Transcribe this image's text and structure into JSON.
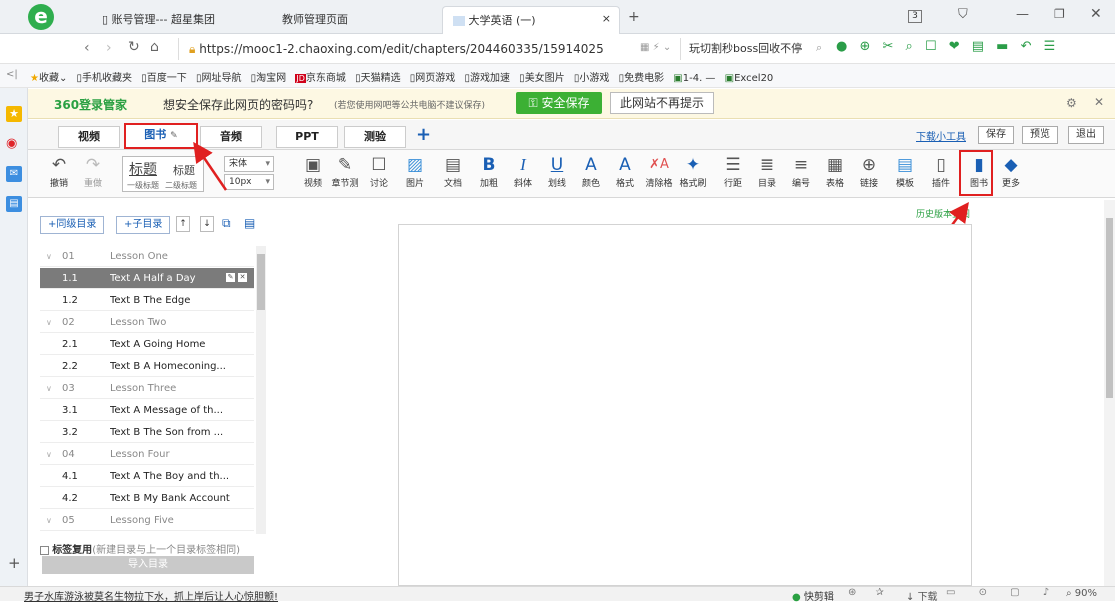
{
  "browser": {
    "tabs": [
      {
        "label": "账号管理--- 超星集团"
      },
      {
        "label": "教师管理页面"
      },
      {
        "label": "大学英语 (一)"
      }
    ],
    "tab_count": "3",
    "url": "https://mooc1-2.chaoxing.com/edit/chapters/204460335/15914025",
    "search_text": "玩切割秒boss回收不停",
    "bookmarks": [
      "收藏",
      "手机收藏夹",
      "百度一下",
      "网址导航",
      "淘宝网",
      "京东商城",
      "天猫精选",
      "网页游戏",
      "游戏加速",
      "美女图片",
      "小游戏",
      "免费电影",
      "1-4. —",
      "Excel20"
    ]
  },
  "password_bar": {
    "brand": "360登录管家",
    "question": "想安全保存此网页的密码吗?",
    "note": "(若您使用网吧等公共电脑不建议保存)",
    "save_button": "安全保存",
    "no_remind_button": "此网站不再提示"
  },
  "editor": {
    "tabs": [
      "视频",
      "图书",
      "音频",
      "PPT",
      "测验"
    ],
    "add_tab": "+",
    "top_links": {
      "download": "下载小工具",
      "save": "保存",
      "preview": "预览",
      "exit": "退出"
    },
    "history_link": "历史版本查阅",
    "toolbar": {
      "undo": "撤销",
      "redo": "重做",
      "heading_main": "标题",
      "heading_alt": "标题",
      "heading_level1": "一级标题",
      "heading_level2": "二级标题",
      "font_family": "宋体",
      "font_size": "10px",
      "items": [
        "视频",
        "章节测",
        "讨论",
        "图片",
        "文档",
        "加粗",
        "斜体",
        "划线",
        "颜色",
        "格式",
        "清除格",
        "格式刷",
        "行距",
        "目录",
        "编号",
        "表格",
        "链接",
        "模板",
        "插件",
        "图书",
        "更多"
      ]
    }
  },
  "sidebar": {
    "add_sibling": "+同级目录",
    "add_child": "+子目录",
    "chapters": [
      {
        "num": "01",
        "title": "Lesson One",
        "items": [
          {
            "num": "1.1",
            "title": "Text A Half a Day",
            "selected": true
          },
          {
            "num": "1.2",
            "title": "Text B The Edge"
          }
        ]
      },
      {
        "num": "02",
        "title": "Lesson Two",
        "items": [
          {
            "num": "2.1",
            "title": "Text A Going Home"
          },
          {
            "num": "2.2",
            "title": "Text B A Homeconing..."
          }
        ]
      },
      {
        "num": "03",
        "title": "Lesson Three",
        "items": [
          {
            "num": "3.1",
            "title": "Text A Message of th..."
          },
          {
            "num": "3.2",
            "title": "Text B The Son from ..."
          }
        ]
      },
      {
        "num": "04",
        "title": "Lesson Four",
        "items": [
          {
            "num": "4.1",
            "title": "Text A The Boy and th..."
          },
          {
            "num": "4.2",
            "title": "Text B My Bank Account"
          }
        ]
      },
      {
        "num": "05",
        "title": "Lessong Five",
        "items": []
      }
    ],
    "tag_reuse_label": "标签复用",
    "tag_reuse_hint": "(新建目录与上一个目录标签相同)",
    "import_button": "导入目录"
  },
  "statusbar": {
    "news": "男子水库游泳被莫名生物拉下水，抓上岸后让人心惊胆颤!",
    "clip": "快剪辑",
    "download": "下载",
    "zoom": "90%"
  },
  "colors": {
    "accent_red": "#e02020",
    "green_button": "#3cb034",
    "selected_row": "#7b7b7b",
    "link_blue": "#1a5fb4"
  }
}
